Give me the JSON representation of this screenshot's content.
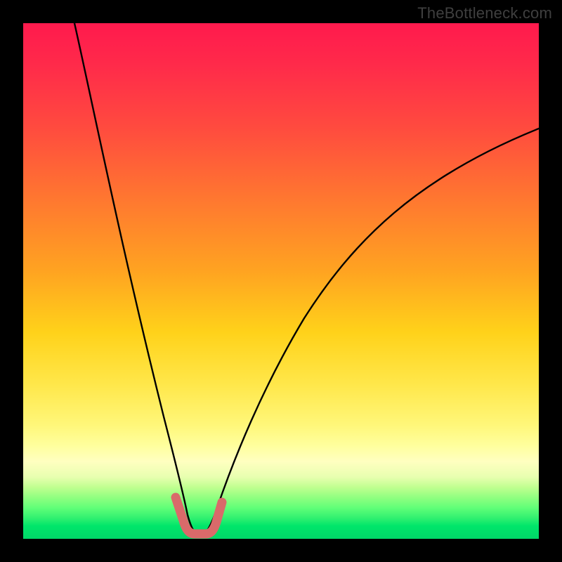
{
  "watermark": "TheBottleneck.com",
  "chart_data": {
    "type": "line",
    "title": "",
    "xlabel": "",
    "ylabel": "",
    "xlim": [
      0,
      100
    ],
    "ylim": [
      0,
      100
    ],
    "series": [
      {
        "name": "bottleneck-curve",
        "x": [
          10,
          14,
          18,
          22,
          26,
          28,
          30,
          31,
          32,
          33,
          34,
          35,
          36,
          38,
          40,
          44,
          50,
          58,
          68,
          80,
          92,
          100
        ],
        "y": [
          100,
          80,
          60,
          40,
          20,
          12,
          5,
          2,
          1,
          1,
          1,
          1,
          2,
          4,
          8,
          16,
          28,
          42,
          56,
          68,
          76,
          80
        ]
      },
      {
        "name": "optimal-marker",
        "x": [
          29.5,
          30.5,
          31.5,
          32.5,
          33.5,
          34.5,
          35.5,
          36.5,
          37.0
        ],
        "y": [
          8.0,
          3.5,
          1.2,
          0.6,
          0.6,
          0.6,
          1.2,
          3.5,
          6.0
        ]
      }
    ],
    "colors": {
      "curve": "#000000",
      "marker": "#d96a6a",
      "gradient_top": "#ff1a4d",
      "gradient_mid": "#ffd21a",
      "gradient_bottom": "#00d768",
      "frame": "#000000"
    }
  }
}
